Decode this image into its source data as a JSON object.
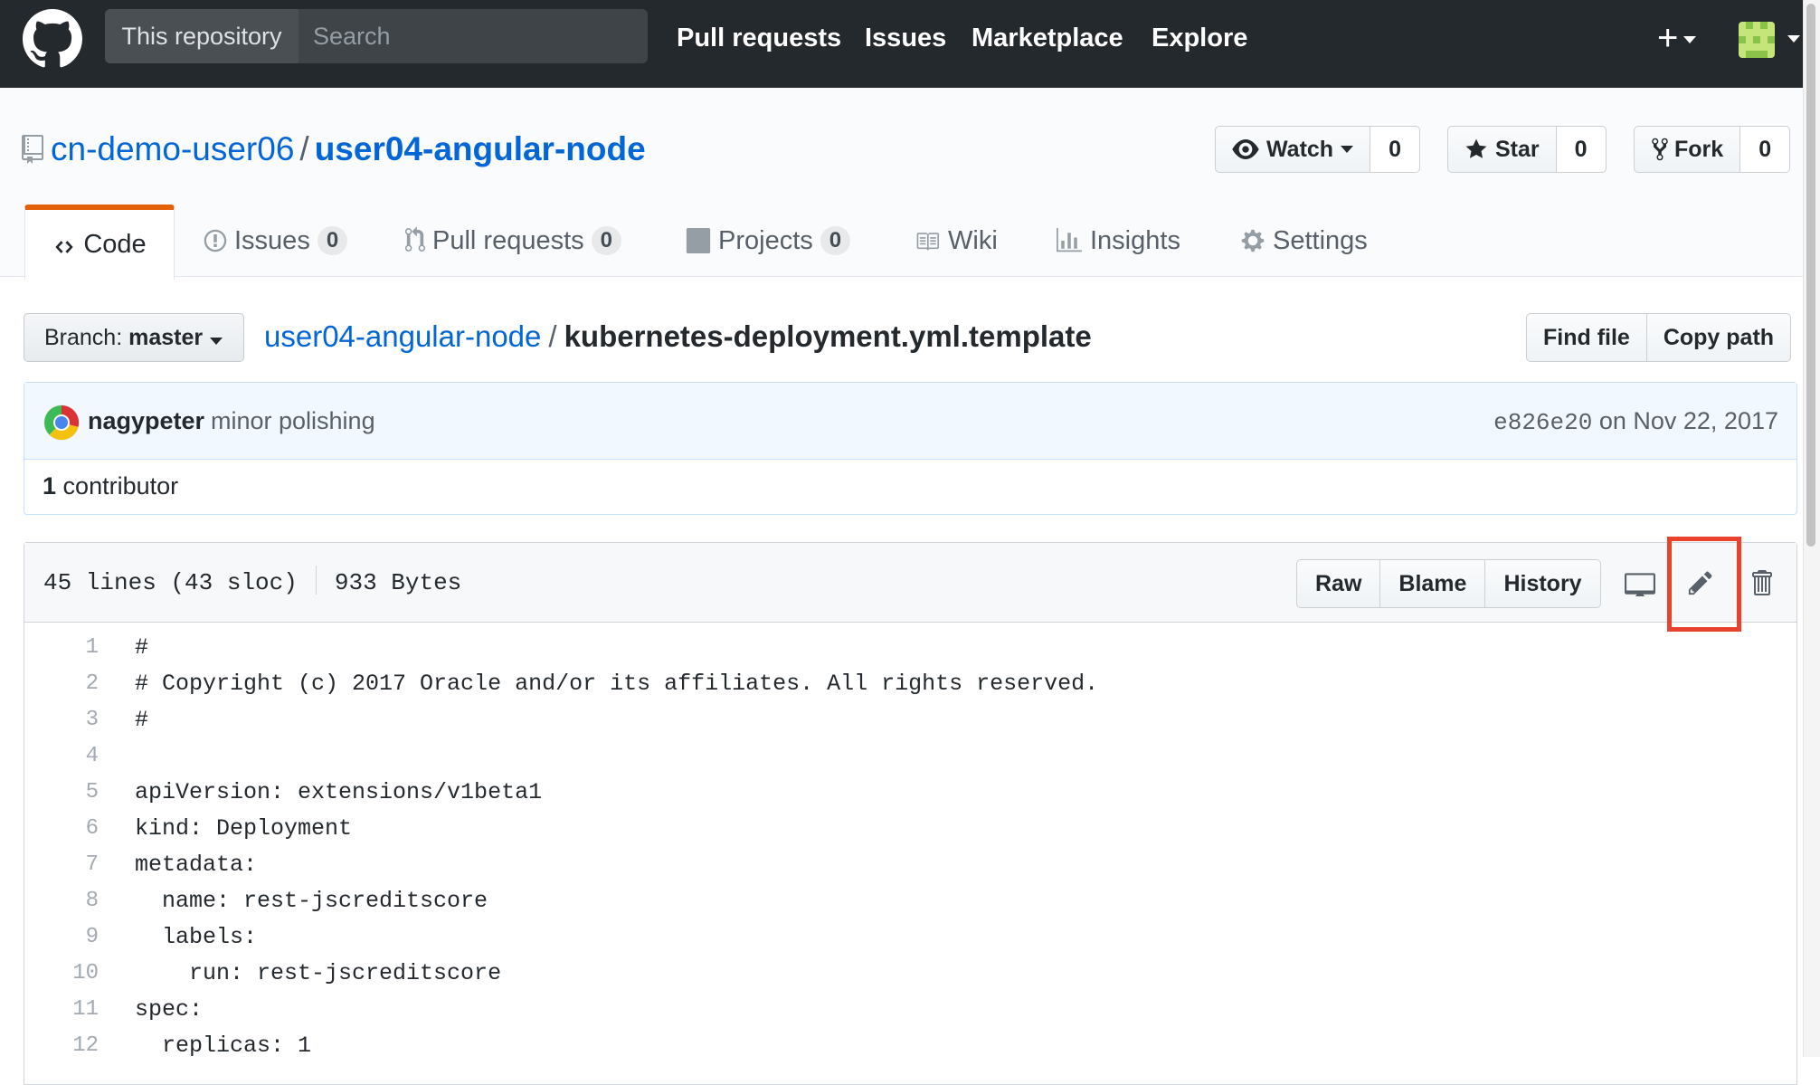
{
  "header": {
    "logo_icon": "github-octocat-icon",
    "search_scope": "This repository",
    "search_placeholder": "Search",
    "nav": [
      "Pull requests",
      "Issues",
      "Marketplace",
      "Explore"
    ],
    "plus_label": "+"
  },
  "repo": {
    "owner": "cn-demo-user06",
    "separator": "/",
    "name": "user04-angular-node",
    "watch_label": "Watch",
    "watch_count": "0",
    "star_label": "Star",
    "star_count": "0",
    "fork_label": "Fork",
    "fork_count": "0"
  },
  "tabs": {
    "code": "Code",
    "issues": "Issues",
    "issues_count": "0",
    "pulls": "Pull requests",
    "pulls_count": "0",
    "projects": "Projects",
    "projects_count": "0",
    "wiki": "Wiki",
    "insights": "Insights",
    "settings": "Settings"
  },
  "file_nav": {
    "branch_prefix": "Branch:",
    "branch_name": "master",
    "crumb_repo": "user04-angular-node",
    "crumb_sep": "/",
    "crumb_file": "kubernetes-deployment.yml.template",
    "find_file": "Find file",
    "copy_path": "Copy path"
  },
  "commit": {
    "author": "nagypeter",
    "message": "minor polishing",
    "sha": "e826e20",
    "date_text": "on Nov 22, 2017",
    "contributors_count": "1",
    "contributors_label": "contributor"
  },
  "file": {
    "lines_info": "45 lines (43 sloc)",
    "size": "933 Bytes",
    "raw": "Raw",
    "blame": "Blame",
    "history": "History",
    "code_lines": [
      {
        "n": "1",
        "text": "#"
      },
      {
        "n": "2",
        "text": "# Copyright (c) 2017 Oracle and/or its affiliates. All rights reserved."
      },
      {
        "n": "3",
        "text": "#"
      },
      {
        "n": "4",
        "text": ""
      },
      {
        "n": "5",
        "text": "apiVersion: extensions/v1beta1"
      },
      {
        "n": "6",
        "text": "kind: Deployment"
      },
      {
        "n": "7",
        "text": "metadata:"
      },
      {
        "n": "8",
        "text": "  name: rest-jscreditscore"
      },
      {
        "n": "9",
        "text": "  labels:"
      },
      {
        "n": "10",
        "text": "    run: rest-jscreditscore"
      },
      {
        "n": "11",
        "text": "spec:"
      },
      {
        "n": "12",
        "text": "  replicas: 1"
      }
    ]
  },
  "colors": {
    "header_bg": "#24292e",
    "link": "#0366d6",
    "tab_accent": "#e36209",
    "highlight": "#e8412c"
  }
}
